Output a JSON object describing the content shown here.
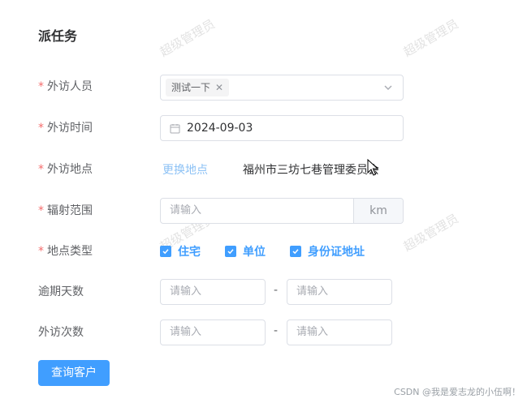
{
  "page": {
    "title": "派任务"
  },
  "form": {
    "visitor": {
      "label": "外访人员",
      "tag": "测试一下"
    },
    "visit_time": {
      "label": "外访时间",
      "value": "2024-09-03"
    },
    "visit_place": {
      "label": "外访地点",
      "link": "更换地点",
      "address": "福州市三坊七巷管理委员会"
    },
    "radius": {
      "label": "辐射范围",
      "placeholder": "请输入",
      "unit": "km"
    },
    "place_type": {
      "label": "地点类型",
      "options": [
        {
          "label": "住宅",
          "checked": true
        },
        {
          "label": "单位",
          "checked": true
        },
        {
          "label": "身份证地址",
          "checked": true
        }
      ]
    },
    "overdue_days": {
      "label": "逾期天数",
      "placeholder_from": "请输入",
      "placeholder_to": "请输入",
      "separator": "-"
    },
    "visit_count": {
      "label": "外访次数",
      "placeholder_from": "请输入",
      "placeholder_to": "请输入",
      "separator": "-"
    },
    "required_mark": "*"
  },
  "actions": {
    "query_button": "查询客户"
  },
  "watermark": "超级管理员",
  "footer": "CSDN @我是爱志龙的小伍啊！",
  "colors": {
    "primary": "#409eff",
    "required": "#f56c6c",
    "link_light": "#8dc2f5"
  }
}
